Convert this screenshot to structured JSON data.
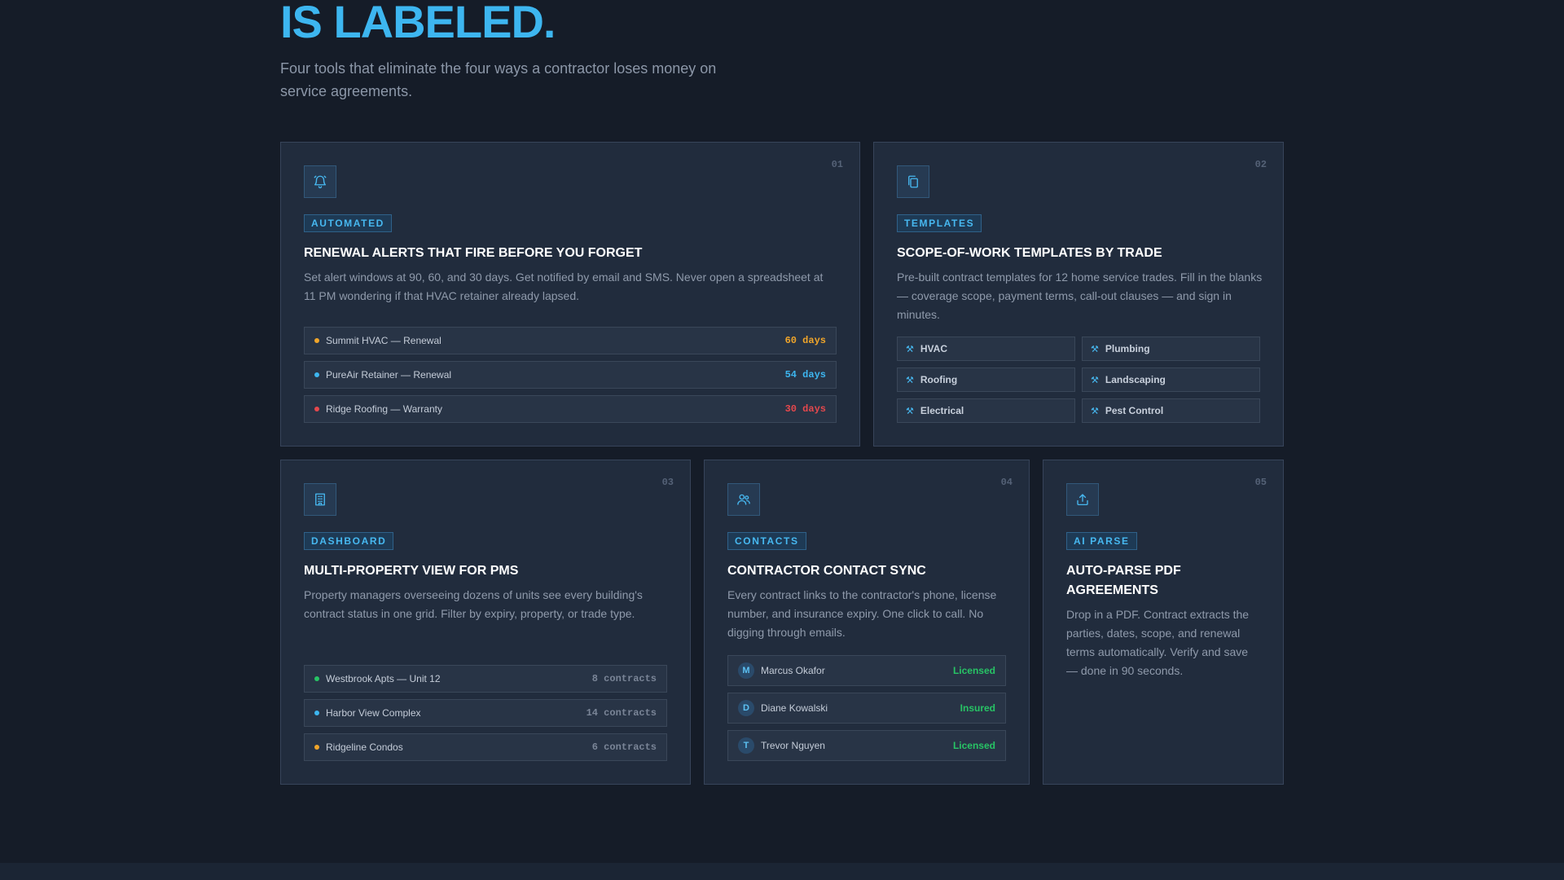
{
  "hero": {
    "title": "IS LABELED.",
    "subtitle": "Four tools that eliminate the four ways a contractor loses money on service agreements."
  },
  "colors": {
    "accent": "#3db6f0",
    "warning": "#f0a52a",
    "info": "#3db6f0",
    "danger": "#e5484d",
    "success": "#27c465"
  },
  "cards": [
    {
      "num": "01",
      "icon": "bell-icon",
      "badge": "AUTOMATED",
      "title": "RENEWAL ALERTS THAT FIRE BEFORE YOU FORGET",
      "desc": "Set alert windows at 90, 60, and 30 days. Get notified by email and SMS. Never open a spreadsheet at 11 PM wondering if that HVAC retainer already lapsed.",
      "rows": [
        {
          "label": "Summit HVAC — Renewal",
          "value": "60 days",
          "color": "#f0a52a"
        },
        {
          "label": "PureAir Retainer — Renewal",
          "value": "54 days",
          "color": "#3db6f0"
        },
        {
          "label": "Ridge Roofing — Warranty",
          "value": "30 days",
          "color": "#e5484d"
        }
      ]
    },
    {
      "num": "02",
      "icon": "copy-documents-icon",
      "badge": "TEMPLATES",
      "title": "SCOPE-OF-WORK TEMPLATES BY TRADE",
      "desc": "Pre-built contract templates for 12 home service trades. Fill in the blanks — coverage scope, payment terms, call-out clauses — and sign in minutes.",
      "trades": [
        "HVAC",
        "Plumbing",
        "Roofing",
        "Landscaping",
        "Electrical",
        "Pest Control"
      ]
    },
    {
      "num": "03",
      "icon": "building-icon",
      "badge": "DASHBOARD",
      "title": "MULTI-PROPERTY VIEW FOR PMS",
      "desc": "Property managers overseeing dozens of units see every building's contract status in one grid. Filter by expiry, property, or trade type.",
      "rows": [
        {
          "label": "Westbrook Apts — Unit 12",
          "value": "8 contracts",
          "color": "#27c465"
        },
        {
          "label": "Harbor View Complex",
          "value": "14 contracts",
          "color": "#3db6f0"
        },
        {
          "label": "Ridgeline Condos",
          "value": "6 contracts",
          "color": "#f0a52a"
        }
      ]
    },
    {
      "num": "04",
      "icon": "users-icon",
      "badge": "CONTACTS",
      "title": "CONTRACTOR CONTACT SYNC",
      "desc": "Every contract links to the contractor's phone, license number, and insurance expiry. One click to call. No digging through emails.",
      "contacts": [
        {
          "initial": "M",
          "name": "Marcus Okafor",
          "status": "Licensed"
        },
        {
          "initial": "D",
          "name": "Diane Kowalski",
          "status": "Insured"
        },
        {
          "initial": "T",
          "name": "Trevor Nguyen",
          "status": "Licensed"
        }
      ]
    },
    {
      "num": "05",
      "icon": "upload-icon",
      "badge": "AI PARSE",
      "title": "AUTO-PARSE PDF AGREEMENTS",
      "desc": "Drop in a PDF. Contract extracts the parties, dates, scope, and renewal terms automatically. Verify and save — done in 90 seconds."
    }
  ]
}
